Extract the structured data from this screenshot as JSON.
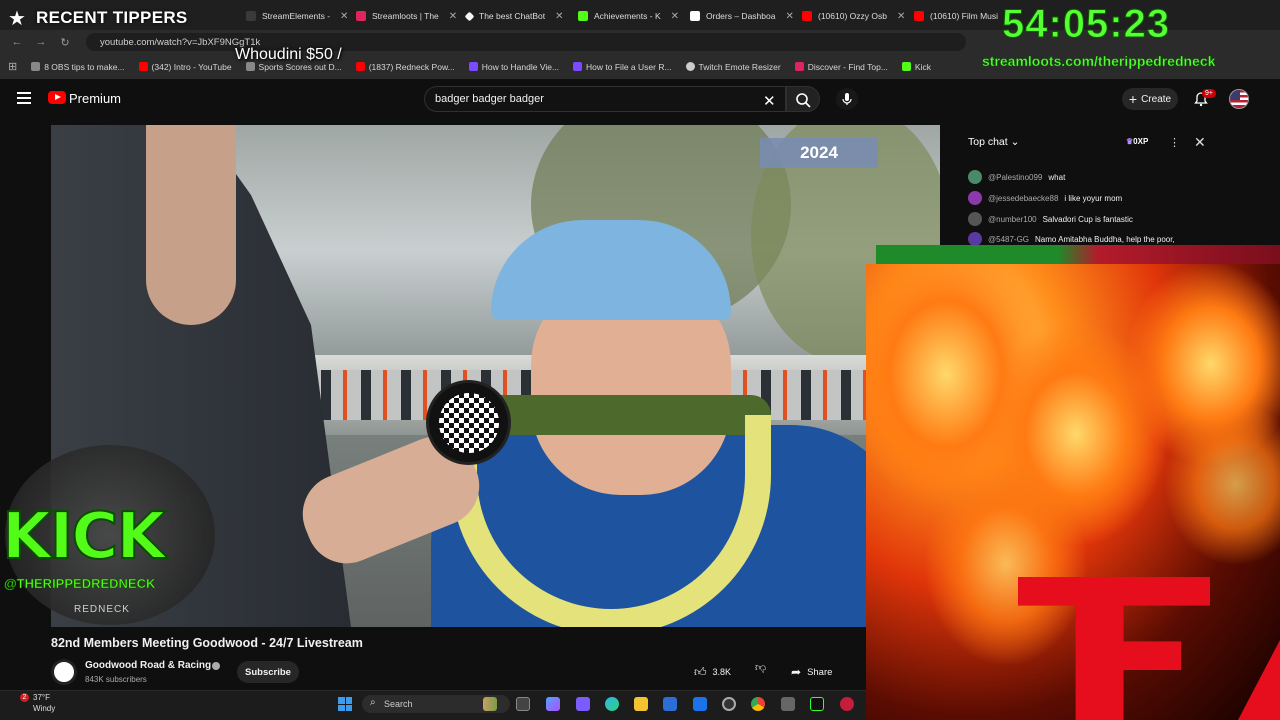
{
  "browser": {
    "tabs": [
      {
        "label": "",
        "color": "#2a2a2a"
      },
      {
        "label": "StreamElements -",
        "color": "#3a3a3a"
      },
      {
        "label": "Streamloots | The",
        "color": "#e0245e"
      },
      {
        "label": "The best ChatBot",
        "color": "#f5f5f5"
      },
      {
        "label": "Achievements - K",
        "color": "#53fc18"
      },
      {
        "label": "Orders – Dashboa",
        "color": "#ffffff"
      },
      {
        "label": "(10610) Ozzy Osb",
        "color": "#ff0000"
      },
      {
        "label": "(10610) Film Musi",
        "color": "#ff0000"
      }
    ],
    "url": "youtube.com/watch?v=JbXF9NGgT1k",
    "bookmarks": [
      {
        "label": "8 OBS tips to make...",
        "color": "#888888"
      },
      {
        "label": "(342) Intro - YouTube",
        "color": "#ff0000"
      },
      {
        "label": "Sports Scores out D...",
        "color": "#888888"
      },
      {
        "label": "(1837) Redneck Pow...",
        "color": "#ff0000"
      },
      {
        "label": "How to Handle Vie...",
        "color": "#7b4cff"
      },
      {
        "label": "How to File a User R...",
        "color": "#7b4cff"
      },
      {
        "label": "Twitch Emote Resizer",
        "color": "#cccccc"
      },
      {
        "label": "Discover - Find Top...",
        "color": "#e0245e"
      },
      {
        "label": "Kick",
        "color": "#53fc18"
      }
    ]
  },
  "youtube": {
    "brand": "Premium",
    "search_query": "badger badger badger",
    "create_label": "Create",
    "notification_count": "9+",
    "video": {
      "overlay_year": "2024",
      "title": "82nd Members Meeting Goodwood - 24/7 Livestream"
    },
    "channel": {
      "name": "Goodwood Road & Racing",
      "subscribers": "843K subscribers",
      "subscribe_label": "Subscribe"
    },
    "actions": {
      "likes": "3.8K",
      "share_label": "Share"
    }
  },
  "chat": {
    "mode": "Top chat",
    "xp": "0XP",
    "messages": [
      {
        "user": "@Palestino099",
        "text": "what",
        "color": "#4a8a6a"
      },
      {
        "user": "@jessedebaecke88",
        "text": "i like yoyur mom",
        "color": "#8a3aaa"
      },
      {
        "user": "@number100",
        "text": "Salvadori Cup is fantastic",
        "color": "#555555"
      },
      {
        "user": "@5487-GG",
        "text": "Namo Amitabha Buddha, help the poor,",
        "color": "#5a3aa0"
      }
    ]
  },
  "overlays": {
    "recent_tippers_label": "RECENT TIPPERS",
    "ticker_text": "Whoudini $50 /",
    "timer": "54:05:23",
    "timer_url": "streamloots.com/therippedredneck",
    "kick_logo": "KICK",
    "kick_handle": "@THERIPPEDREDNECK",
    "kick_sub": "REDNECK"
  },
  "taskbar": {
    "notification_badge": "2",
    "temperature": "37°F",
    "weather": "Windy",
    "search_placeholder": "Search"
  }
}
